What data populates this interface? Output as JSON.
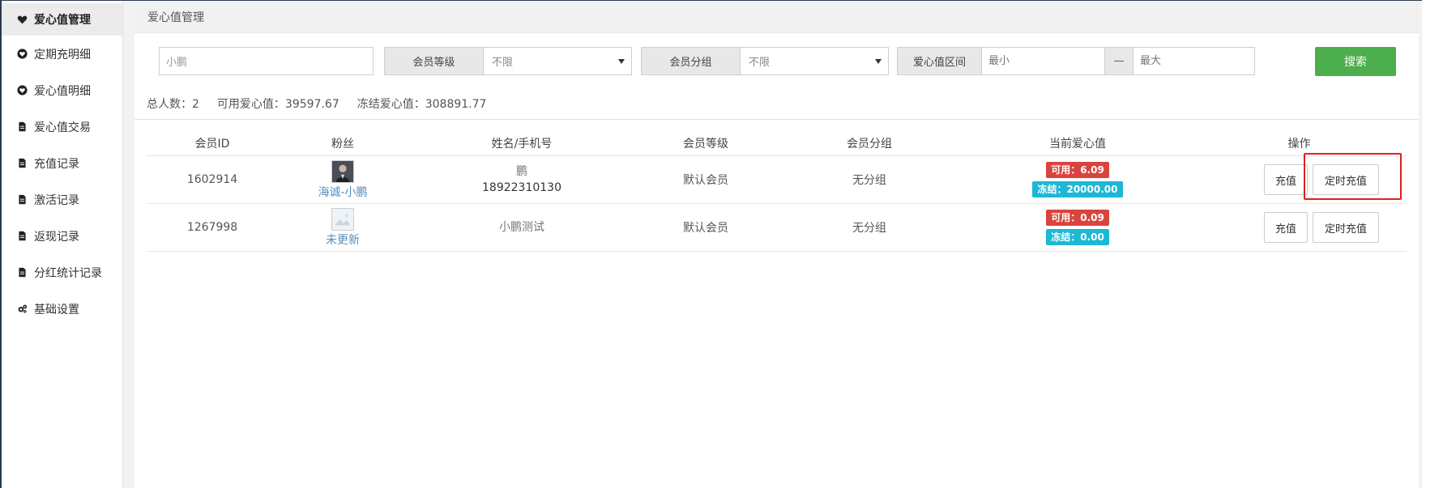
{
  "sidebar": {
    "items": [
      {
        "label": "爱心值管理",
        "icon": "heart-icon",
        "active": true
      },
      {
        "label": "定期充明细",
        "icon": "heart-circle-icon"
      },
      {
        "label": "爱心值明细",
        "icon": "heart-circle-icon"
      },
      {
        "label": "爱心值交易",
        "icon": "document-icon"
      },
      {
        "label": "充值记录",
        "icon": "document-icon"
      },
      {
        "label": "激活记录",
        "icon": "document-icon"
      },
      {
        "label": "返现记录",
        "icon": "document-icon"
      },
      {
        "label": "分红统计记录",
        "icon": "document-icon"
      },
      {
        "label": "基础设置",
        "icon": "gears-icon"
      }
    ]
  },
  "breadcrumb": {
    "title": "爱心值管理"
  },
  "filters": {
    "search_value": "小鹏",
    "member_level": {
      "label": "会员等级",
      "value": "不限"
    },
    "member_group": {
      "label": "会员分组",
      "value": "不限"
    },
    "love_range": {
      "label": "爱心值区间",
      "min_placeholder": "最小",
      "sep": "—",
      "max_placeholder": "最大"
    },
    "search_button": "搜索"
  },
  "stats": {
    "total": "总人数：2",
    "available": "可用爱心值：39597.67",
    "frozen": "冻结爱心值：308891.77"
  },
  "table": {
    "headers": [
      "会员ID",
      "粉丝",
      "姓名/手机号",
      "会员等级",
      "会员分组",
      "当前爱心值",
      "操作"
    ],
    "rows": [
      {
        "id": "1602914",
        "fan_name": "海诚-小鹏",
        "avatar": "photo",
        "name": "鹏",
        "phone": "18922310130",
        "level": "默认会员",
        "group": "无分组",
        "available": "可用：6.09",
        "frozen": "冻结：20000.00",
        "btn_charge": "充值",
        "btn_timed": "定时充值"
      },
      {
        "id": "1267998",
        "fan_name": "未更新",
        "avatar": "blank",
        "name": "小鹏测试",
        "phone": "",
        "level": "默认会员",
        "group": "无分组",
        "available": "可用：0.09",
        "frozen": "冻结：0.00",
        "btn_charge": "充值",
        "btn_timed": "定时充值"
      }
    ]
  },
  "colors": {
    "search_button": "#4cae4c",
    "badge_available": "#d9443f",
    "badge_frozen": "#1cb8d6",
    "highlight": "#e02020"
  }
}
